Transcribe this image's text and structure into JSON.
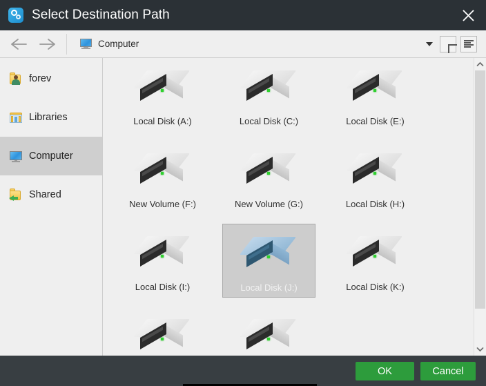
{
  "window": {
    "title": "Select Destination Path",
    "app_icon": "app-gear-icon",
    "close_label": "✕",
    "titlebar_color": "#2b3136",
    "footer_color": "#383e42",
    "accent_color": "#2d9c3c"
  },
  "toolbar": {
    "back_icon": "arrow-left-icon",
    "forward_icon": "arrow-right-icon",
    "location_icon": "computer-monitor-icon",
    "location_text": "Computer",
    "dropdown_icon": "chevron-down-icon",
    "new_folder_icon": "plus-icon",
    "view_list_icon": "list-view-icon"
  },
  "sidebar": {
    "items": [
      {
        "label": "forev",
        "icon": "user-folder-icon",
        "selected": false
      },
      {
        "label": "Libraries",
        "icon": "libraries-icon",
        "selected": false
      },
      {
        "label": "Computer",
        "icon": "computer-monitor-icon",
        "selected": true
      },
      {
        "label": "Shared",
        "icon": "shared-folder-icon",
        "selected": false
      }
    ]
  },
  "files": {
    "rows": [
      [
        {
          "label": "Local Disk (A:)",
          "icon": "hard-drive-icon",
          "selected": false,
          "visible": true
        },
        {
          "label": "Local Disk (C:)",
          "icon": "hard-drive-icon",
          "selected": false,
          "visible": true
        },
        {
          "label": "Local Disk (E:)",
          "icon": "hard-drive-icon",
          "selected": false,
          "visible": true
        }
      ],
      [
        {
          "label": "New Volume (F:)",
          "icon": "hard-drive-icon",
          "selected": false,
          "visible": true
        },
        {
          "label": "New Volume (G:)",
          "icon": "hard-drive-icon",
          "selected": false,
          "visible": true
        },
        {
          "label": "Local Disk (H:)",
          "icon": "hard-drive-icon",
          "selected": false,
          "visible": true
        }
      ],
      [
        {
          "label": "Local Disk (I:)",
          "icon": "hard-drive-icon",
          "selected": false,
          "visible": true
        },
        {
          "label": "Local Disk (J:)",
          "icon": "hard-drive-icon",
          "selected": true,
          "visible": true
        },
        {
          "label": "Local Disk (K:)",
          "icon": "hard-drive-icon",
          "selected": false,
          "visible": true
        }
      ],
      [
        {
          "label": "",
          "icon": "hard-drive-icon",
          "selected": false,
          "visible": true
        },
        {
          "label": "",
          "icon": "hard-drive-icon",
          "selected": false,
          "visible": true
        },
        {
          "label": "",
          "icon": "hard-drive-icon",
          "selected": false,
          "visible": false
        }
      ]
    ]
  },
  "scrollbar": {
    "up_icon": "chevron-up-icon",
    "down_icon": "chevron-down-icon"
  },
  "footer": {
    "ok_label": "OK",
    "cancel_label": "Cancel"
  }
}
